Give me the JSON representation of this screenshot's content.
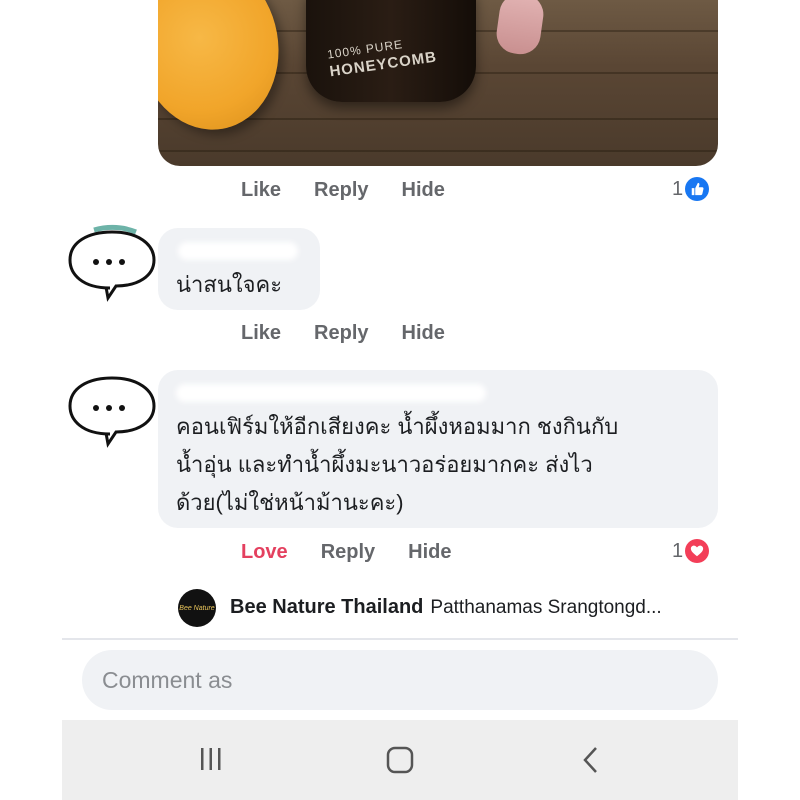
{
  "photo": {
    "jar_label_line1": "100% PURE",
    "jar_label_line2": "HONEYCOMB"
  },
  "comment1": {
    "actions": {
      "like": "Like",
      "reply": "Reply",
      "hide": "Hide"
    },
    "reaction_count": "1",
    "reaction_icon": "like-thumb-icon",
    "reaction_color": "#1877f2"
  },
  "comment2": {
    "text": "น่าสนใจคะ",
    "actions": {
      "like": "Like",
      "reply": "Reply",
      "hide": "Hide"
    }
  },
  "comment3": {
    "lines": [
      "คอนเฟิร์มให้อีกเสียงคะ น้ำผึ้งหอมมาก ชงกินกับ",
      "น้ำอุ่น และทำน้ำผึ้งมะนาวอร่อยมากคะ ส่งไว",
      "ด้วย(ไม่ใช่หน้าม้านะคะ)"
    ],
    "actions": {
      "love": "Love",
      "reply": "Reply",
      "hide": "Hide"
    },
    "reaction_count": "1",
    "reaction_icon": "heart-icon",
    "reaction_color": "#f33e58",
    "love_color": "#e4405f"
  },
  "page_reply": {
    "page_name": "Bee Nature Thailand",
    "reply_preview": "Patthanamas Srangtongd...",
    "logo_text": "Bee Nature"
  },
  "composer": {
    "placeholder": "Comment as"
  },
  "navbar": {
    "recents_icon": "recents-icon",
    "home_icon": "home-icon",
    "back_icon": "back-icon"
  }
}
